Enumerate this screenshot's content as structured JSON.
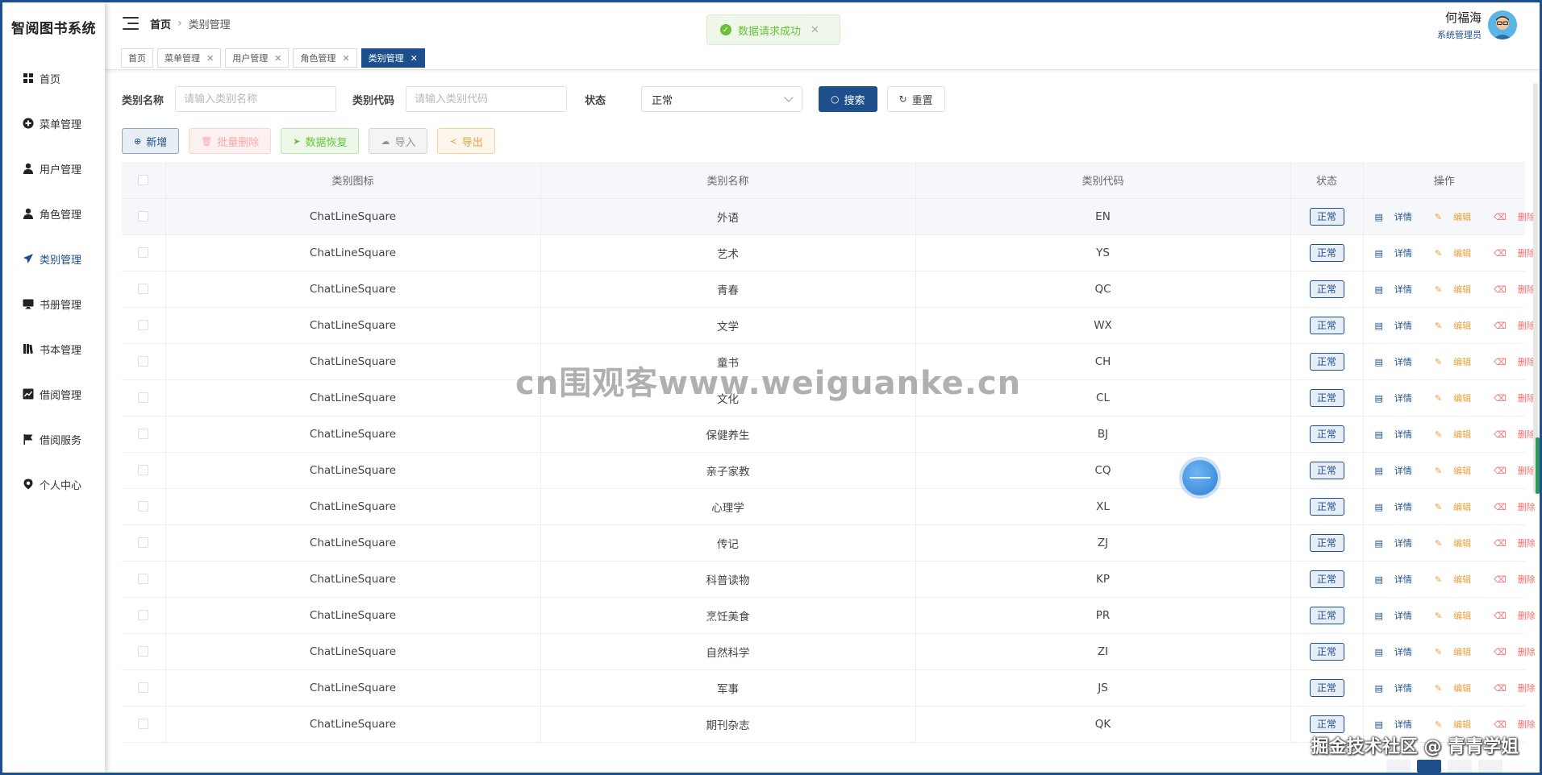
{
  "app": {
    "title": "智阅图书系统"
  },
  "colors": {
    "primary": "#1c4f8c",
    "success": "#67c23a",
    "warning": "#e6a23c",
    "danger": "#f56c6c",
    "info": "#909399"
  },
  "sidebar": {
    "items": [
      {
        "label": "首页",
        "icon": "grid-icon"
      },
      {
        "label": "菜单管理",
        "icon": "plus-circle-icon"
      },
      {
        "label": "用户管理",
        "icon": "user-icon"
      },
      {
        "label": "角色管理",
        "icon": "user-icon"
      },
      {
        "label": "类别管理",
        "icon": "send-icon",
        "active": true
      },
      {
        "label": "书册管理",
        "icon": "monitor-icon"
      },
      {
        "label": "书本管理",
        "icon": "books-icon"
      },
      {
        "label": "借阅管理",
        "icon": "chart-icon"
      },
      {
        "label": "借阅服务",
        "icon": "flag-icon"
      },
      {
        "label": "个人中心",
        "icon": "location-icon"
      }
    ]
  },
  "header": {
    "breadcrumb": {
      "home": "首页",
      "current": "类别管理"
    },
    "user": {
      "name": "何福海",
      "role": "系统管理员"
    }
  },
  "toast": {
    "message": "数据请求成功"
  },
  "tabs": [
    {
      "label": "首页",
      "closable": false
    },
    {
      "label": "菜单管理",
      "closable": true
    },
    {
      "label": "用户管理",
      "closable": true
    },
    {
      "label": "角色管理",
      "closable": true
    },
    {
      "label": "类别管理",
      "closable": true,
      "active": true
    }
  ],
  "filter": {
    "name_label": "类别名称",
    "name_placeholder": "请输入类别名称",
    "code_label": "类别代码",
    "code_placeholder": "请输入类别代码",
    "status_label": "状态",
    "status_value": "正常",
    "search_label": "搜索",
    "reset_label": "重置"
  },
  "actions": {
    "add": "新增",
    "batch_delete": "批量删除",
    "restore": "数据恢复",
    "import": "导入",
    "export": "导出"
  },
  "table": {
    "columns": [
      "类别图标",
      "类别名称",
      "类别代码",
      "状态",
      "操作"
    ],
    "op_labels": {
      "detail": "详情",
      "edit": "编辑",
      "delete": "删除"
    },
    "rows": [
      {
        "icon": "ChatLineSquare",
        "name": "外语",
        "code": "EN",
        "status": "正常"
      },
      {
        "icon": "ChatLineSquare",
        "name": "艺术",
        "code": "YS",
        "status": "正常"
      },
      {
        "icon": "ChatLineSquare",
        "name": "青春",
        "code": "QC",
        "status": "正常"
      },
      {
        "icon": "ChatLineSquare",
        "name": "文学",
        "code": "WX",
        "status": "正常"
      },
      {
        "icon": "ChatLineSquare",
        "name": "童书",
        "code": "CH",
        "status": "正常"
      },
      {
        "icon": "ChatLineSquare",
        "name": "文化",
        "code": "CL",
        "status": "正常"
      },
      {
        "icon": "ChatLineSquare",
        "name": "保健养生",
        "code": "BJ",
        "status": "正常"
      },
      {
        "icon": "ChatLineSquare",
        "name": "亲子家教",
        "code": "CQ",
        "status": "正常"
      },
      {
        "icon": "ChatLineSquare",
        "name": "心理学",
        "code": "XL",
        "status": "正常"
      },
      {
        "icon": "ChatLineSquare",
        "name": "传记",
        "code": "ZJ",
        "status": "正常"
      },
      {
        "icon": "ChatLineSquare",
        "name": "科普读物",
        "code": "KP",
        "status": "正常"
      },
      {
        "icon": "ChatLineSquare",
        "name": "烹饪美食",
        "code": "PR",
        "status": "正常"
      },
      {
        "icon": "ChatLineSquare",
        "name": "自然科学",
        "code": "ZI",
        "status": "正常"
      },
      {
        "icon": "ChatLineSquare",
        "name": "军事",
        "code": "JS",
        "status": "正常"
      },
      {
        "icon": "ChatLineSquare",
        "name": "期刊杂志",
        "code": "QK",
        "status": "正常"
      }
    ]
  },
  "watermarks": {
    "center": "cn围观客www.weiguanke.cn",
    "bottom": "掘金技术社区 @ 青青学姐"
  }
}
